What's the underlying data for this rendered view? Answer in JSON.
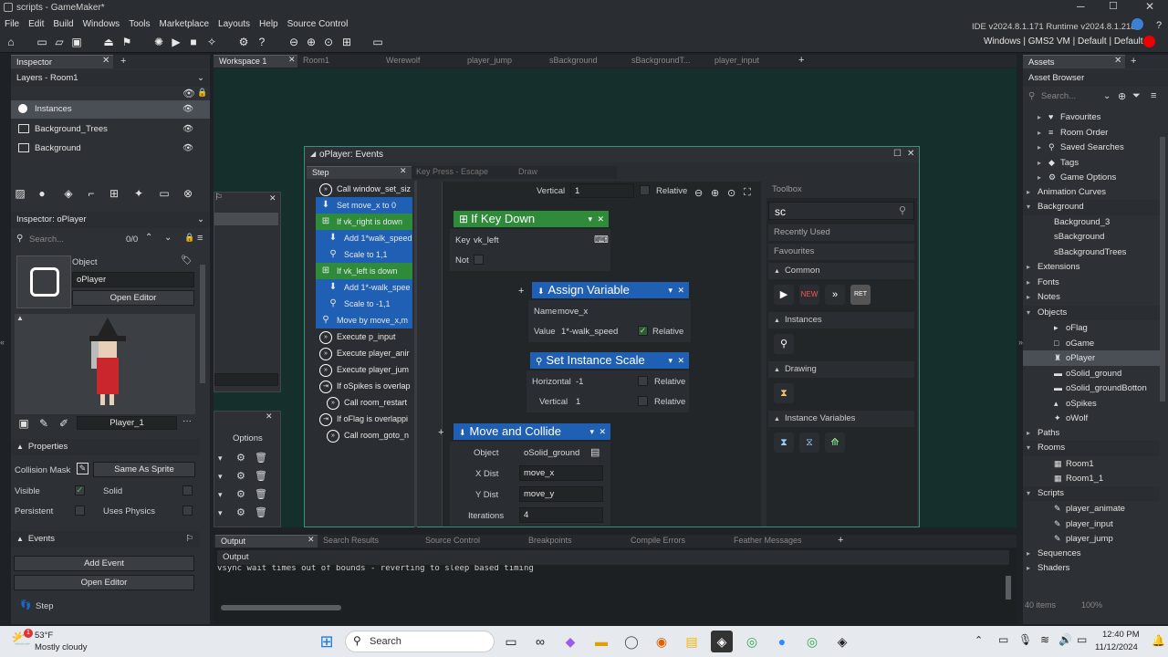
{
  "window": {
    "title": "scripts - GameMaker*",
    "ide_version": "IDE v2024.8.1.171  Runtime v2024.8.1.218",
    "target": "Windows | GMS2 VM | Default | Default"
  },
  "menu": [
    "File",
    "Edit",
    "Build",
    "Windows",
    "Tools",
    "Marketplace",
    "Layouts",
    "Help",
    "Source Control"
  ],
  "inspector": {
    "tab": "Inspector",
    "layers_title": "Layers - Room1",
    "layers": [
      "Instances",
      "Background_Trees",
      "Background"
    ],
    "sub_title": "Inspector: oPlayer",
    "search_placeholder": "Search...",
    "count": "0/0",
    "object_label": "Object",
    "object_name": "oPlayer",
    "open_editor": "Open Editor",
    "sprite_name": "Player_1",
    "properties": "Properties",
    "collision_mask_label": "Collision Mask",
    "collision_mask_value": "Same As Sprite",
    "visible": "Visible",
    "solid": "Solid",
    "persistent": "Persistent",
    "uses_physics": "Uses Physics",
    "events_title": "Events",
    "add_event": "Add Event",
    "open_editor2": "Open Editor",
    "event_step": "Step"
  },
  "workspace_tabs": [
    "Workspace 1",
    "Room1",
    "Werewolf",
    "player_jump",
    "sBackground",
    "sBackgroundT...",
    "player_input"
  ],
  "bg_panel": {
    "options": "Options"
  },
  "events_window": {
    "title": "oPlayer: Events",
    "tabs": [
      "Step",
      "Key Press - Escape",
      "Draw"
    ],
    "events": [
      {
        "text": "Call window_set_siz",
        "type": "call"
      },
      {
        "text": "Set move_x to 0",
        "type": "var"
      },
      {
        "text": "If vk_right is down",
        "type": "if"
      },
      {
        "text": "Add 1*walk_speed",
        "type": "var",
        "indent": true
      },
      {
        "text": "Scale to 1,1",
        "type": "scale",
        "indent": true
      },
      {
        "text": "If vk_left is down",
        "type": "if"
      },
      {
        "text": "Add 1*-walk_spee",
        "type": "var",
        "indent": true
      },
      {
        "text": "Scale to -1,1",
        "type": "scale",
        "indent": true
      },
      {
        "text": "Move by move_x,m",
        "type": "move"
      },
      {
        "text": "Execute p_input",
        "type": "call"
      },
      {
        "text": "Execute player_anir",
        "type": "call"
      },
      {
        "text": "Execute player_jum",
        "type": "call"
      },
      {
        "text": "If oSpikes is overlap",
        "type": "ifc"
      },
      {
        "text": "Call room_restart",
        "type": "call",
        "indent": true
      },
      {
        "text": "If oFlag is overlappi",
        "type": "ifc"
      },
      {
        "text": "Call room_goto_n",
        "type": "call",
        "indent": true
      }
    ]
  },
  "blocks": {
    "top_vertical_label": "Vertical",
    "top_vertical_value": "1",
    "relative": "Relative",
    "if_key_down": {
      "title": "If Key Down",
      "key_label": "Key",
      "key_value": "vk_left",
      "not_label": "Not"
    },
    "assign_variable": {
      "title": "Assign Variable",
      "name_label": "Name",
      "name_value": "move_x",
      "value_label": "Value",
      "value_value": "1*-walk_speed"
    },
    "set_instance_scale": {
      "title": "Set Instance Scale",
      "h_label": "Horizontal",
      "h_value": "-1",
      "v_label": "Vertical",
      "v_value": "1"
    },
    "move_and_collide": {
      "title": "Move and Collide",
      "object_label": "Object",
      "object_value": "oSolid_ground",
      "xdist_label": "X Dist",
      "xdist_value": "move_x",
      "ydist_label": "Y Dist",
      "ydist_value": "move_y",
      "iter_label": "Iterations",
      "iter_value": "4"
    }
  },
  "toolbox": {
    "title": "Toolbox",
    "search_value": "sc",
    "recently_used": "Recently Used",
    "favourites": "Favourites",
    "common": "Common",
    "instances": "Instances",
    "drawing": "Drawing",
    "instance_variables": "Instance Variables"
  },
  "output": {
    "tabs": [
      "Output",
      "Search Results",
      "Source Control",
      "Breakpoints",
      "Compile Errors",
      "Feather Messages"
    ],
    "subtab": "Output",
    "text": "vsync wait times out of bounds - reverting to sleep based timing"
  },
  "assets": {
    "tab": "Assets",
    "title": "Asset Browser",
    "search_placeholder": "Search...",
    "items_count": "40 items",
    "zoom": "100%",
    "tree": [
      {
        "t": "Favourites",
        "lvl": 1,
        "ic": "♥"
      },
      {
        "t": "Room Order",
        "lvl": 1,
        "ic": "≡"
      },
      {
        "t": "Saved Searches",
        "lvl": 1,
        "ic": "⚲"
      },
      {
        "t": "Tags",
        "lvl": 1,
        "ic": "◆"
      },
      {
        "t": "Game Options",
        "lvl": 1,
        "ic": "⚙"
      },
      {
        "t": "Animation Curves",
        "lvl": 0,
        "ic": ""
      },
      {
        "t": "Background",
        "lvl": 0,
        "ic": "",
        "open": true
      },
      {
        "t": "Background_3",
        "lvl": 2,
        "ic": ""
      },
      {
        "t": "sBackground",
        "lvl": 2,
        "ic": ""
      },
      {
        "t": "sBackgroundTrees",
        "lvl": 2,
        "ic": ""
      },
      {
        "t": "Extensions",
        "lvl": 0,
        "ic": ""
      },
      {
        "t": "Fonts",
        "lvl": 0,
        "ic": ""
      },
      {
        "t": "Notes",
        "lvl": 0,
        "ic": ""
      },
      {
        "t": "Objects",
        "lvl": 0,
        "ic": "",
        "open": true
      },
      {
        "t": "oFlag",
        "lvl": 2,
        "ic": "▸"
      },
      {
        "t": "oGame",
        "lvl": 2,
        "ic": "□"
      },
      {
        "t": "oPlayer",
        "lvl": 2,
        "ic": "♜",
        "sel": true
      },
      {
        "t": "oSolid_ground",
        "lvl": 2,
        "ic": "▬"
      },
      {
        "t": "oSolid_groundBotton",
        "lvl": 2,
        "ic": "▬"
      },
      {
        "t": "oSpikes",
        "lvl": 2,
        "ic": "▴"
      },
      {
        "t": "oWolf",
        "lvl": 2,
        "ic": "✦"
      },
      {
        "t": "Paths",
        "lvl": 0,
        "ic": ""
      },
      {
        "t": "Rooms",
        "lvl": 0,
        "ic": "",
        "open": true
      },
      {
        "t": "Room1",
        "lvl": 2,
        "ic": "▦"
      },
      {
        "t": "Room1_1",
        "lvl": 2,
        "ic": "▦"
      },
      {
        "t": "Scripts",
        "lvl": 0,
        "ic": "",
        "open": true
      },
      {
        "t": "player_animate",
        "lvl": 2,
        "ic": "✎"
      },
      {
        "t": "player_input",
        "lvl": 2,
        "ic": "✎"
      },
      {
        "t": "player_jump",
        "lvl": 2,
        "ic": "✎"
      },
      {
        "t": "Sequences",
        "lvl": 0,
        "ic": ""
      },
      {
        "t": "Shaders",
        "lvl": 0,
        "ic": ""
      }
    ]
  },
  "taskbar": {
    "temp": "53°F",
    "weather": "Mostly cloudy",
    "search": "Search",
    "time": "12:40 PM",
    "date": "11/12/2024",
    "badge": "1"
  },
  "colors": {
    "green_block": "#2e8b3a",
    "blue_block": "#1f5fb4",
    "accent": "#3b80d6"
  }
}
